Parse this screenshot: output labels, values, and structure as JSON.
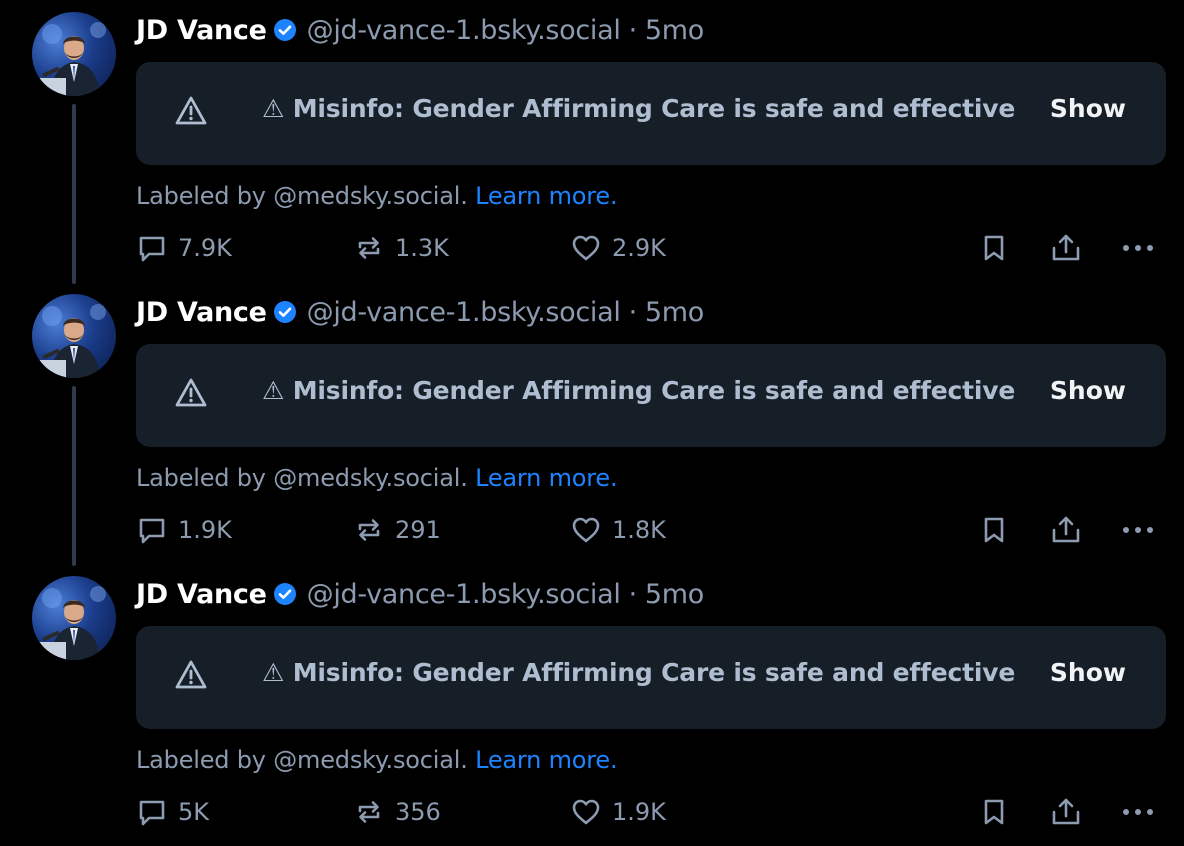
{
  "colors": {
    "background": "#000000",
    "card": "#161e27",
    "muted_text": "#8d9bb0",
    "label_text": "#aebdcf",
    "link": "#1d83ff",
    "verified": "#1d83ff",
    "thread_line": "#2f3b4c"
  },
  "icons": {
    "verified": "verified-badge-icon",
    "warning": "warning-triangle-icon",
    "reply": "speech-bubble-icon",
    "repost": "repost-arrows-icon",
    "like": "heart-icon",
    "bookmark": "bookmark-icon",
    "share": "share-upload-icon",
    "more": "ellipsis-icon"
  },
  "posts": [
    {
      "author": {
        "name": "JD Vance",
        "handle": "@jd-vance-1.bsky.social",
        "separator": "·",
        "time": "5mo"
      },
      "label": {
        "text": "⚠ Misinfo: Gender Affirming Care is safe and effective",
        "show": "Show"
      },
      "labeled_by": {
        "text": "Labeled by @medsky.social.",
        "link": "Learn more."
      },
      "stats": {
        "replies": "7.9K",
        "reposts": "1.3K",
        "likes": "2.9K"
      }
    },
    {
      "author": {
        "name": "JD Vance",
        "handle": "@jd-vance-1.bsky.social",
        "separator": "·",
        "time": "5mo"
      },
      "label": {
        "text": "⚠ Misinfo: Gender Affirming Care is safe and effective",
        "show": "Show"
      },
      "labeled_by": {
        "text": "Labeled by @medsky.social.",
        "link": "Learn more."
      },
      "stats": {
        "replies": "1.9K",
        "reposts": "291",
        "likes": "1.8K"
      }
    },
    {
      "author": {
        "name": "JD Vance",
        "handle": "@jd-vance-1.bsky.social",
        "separator": "·",
        "time": "5mo"
      },
      "label": {
        "text": "⚠ Misinfo: Gender Affirming Care is safe and effective",
        "show": "Show"
      },
      "labeled_by": {
        "text": "Labeled by @medsky.social.",
        "link": "Learn more."
      },
      "stats": {
        "replies": "5K",
        "reposts": "356",
        "likes": "1.9K"
      }
    }
  ]
}
